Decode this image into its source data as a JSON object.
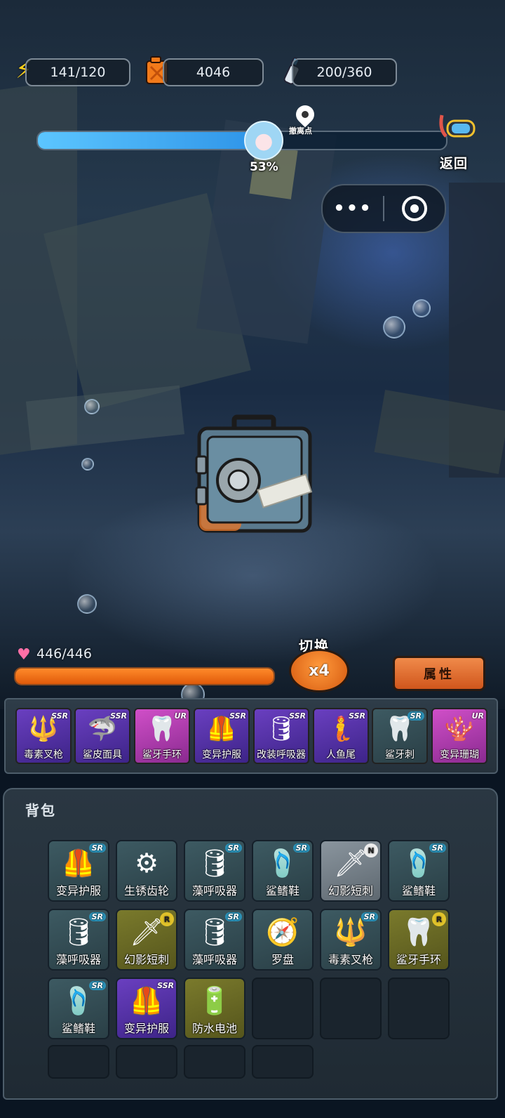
{
  "resources": {
    "energy": {
      "value": "141/120",
      "icon": "lightning-icon"
    },
    "fuel": {
      "value": "4046",
      "icon": "fuel-can-icon"
    },
    "oxygen": {
      "value": "200/360",
      "icon": "oxygen-spray-icon"
    }
  },
  "dive": {
    "progress_percent": 53,
    "progress_label": "53%",
    "evac_point_label": "撤离点",
    "return_label": "返回"
  },
  "player": {
    "hp": "446/446",
    "hp_fraction": 1.0
  },
  "controls": {
    "switch_label": "切换",
    "speed_label": "x4",
    "attributes_label": "属性"
  },
  "equipped": [
    {
      "name": "毒素叉枪",
      "rarity": "SSR",
      "quality": "purple",
      "icon": "trident-icon"
    },
    {
      "name": "鲨皮面具",
      "rarity": "SSR",
      "quality": "purple",
      "icon": "shark-mask-icon"
    },
    {
      "name": "鲨牙手环",
      "rarity": "UR",
      "quality": "pink",
      "icon": "fang-bracelet-icon"
    },
    {
      "name": "变异护服",
      "rarity": "SSR",
      "quality": "purple",
      "icon": "diving-suit-icon"
    },
    {
      "name": "改装呼吸器",
      "rarity": "SSR",
      "quality": "purple",
      "icon": "air-tank-icon"
    },
    {
      "name": "人鱼尾",
      "rarity": "SSR",
      "quality": "purple",
      "icon": "mermaid-tail-icon"
    },
    {
      "name": "鲨牙刺",
      "rarity": "SR",
      "quality": "teal",
      "icon": "shark-teeth-icon"
    },
    {
      "name": "变异珊瑚",
      "rarity": "UR",
      "quality": "pink",
      "icon": "coral-icon"
    }
  ],
  "backpack": {
    "title": "背包",
    "items": [
      {
        "name": "变异护服",
        "rarity": "SR",
        "quality": "teal",
        "icon": "diving-suit-icon"
      },
      {
        "name": "生锈齿轮",
        "rarity": "",
        "quality": "teal",
        "icon": "gear-icon"
      },
      {
        "name": "藻呼吸器",
        "rarity": "SR",
        "quality": "teal",
        "icon": "air-tank-icon"
      },
      {
        "name": "鲨鳍鞋",
        "rarity": "SR",
        "quality": "teal",
        "icon": "fins-icon"
      },
      {
        "name": "幻影短刺",
        "rarity": "N",
        "quality": "gray",
        "icon": "dagger-icon"
      },
      {
        "name": "鲨鳍鞋",
        "rarity": "SR",
        "quality": "teal",
        "icon": "fins-icon"
      },
      {
        "name": "藻呼吸器",
        "rarity": "SR",
        "quality": "teal",
        "icon": "air-tank-icon"
      },
      {
        "name": "幻影短刺",
        "rarity": "R",
        "quality": "gold",
        "icon": "dagger-icon"
      },
      {
        "name": "藻呼吸器",
        "rarity": "SR",
        "quality": "teal",
        "icon": "air-tank-icon"
      },
      {
        "name": "罗盘",
        "rarity": "",
        "quality": "teal",
        "icon": "compass-icon"
      },
      {
        "name": "毒素叉枪",
        "rarity": "SR",
        "quality": "teal",
        "icon": "trident-icon"
      },
      {
        "name": "鲨牙手环",
        "rarity": "R",
        "quality": "gold",
        "icon": "fang-bracelet-icon"
      },
      {
        "name": "鲨鳍鞋",
        "rarity": "SR",
        "quality": "teal",
        "icon": "fins-icon"
      },
      {
        "name": "变异护服",
        "rarity": "SSR",
        "quality": "purple",
        "icon": "diving-suit-icon"
      },
      {
        "name": "防水电池",
        "rarity": "",
        "quality": "gold",
        "icon": "battery-icon"
      }
    ]
  }
}
